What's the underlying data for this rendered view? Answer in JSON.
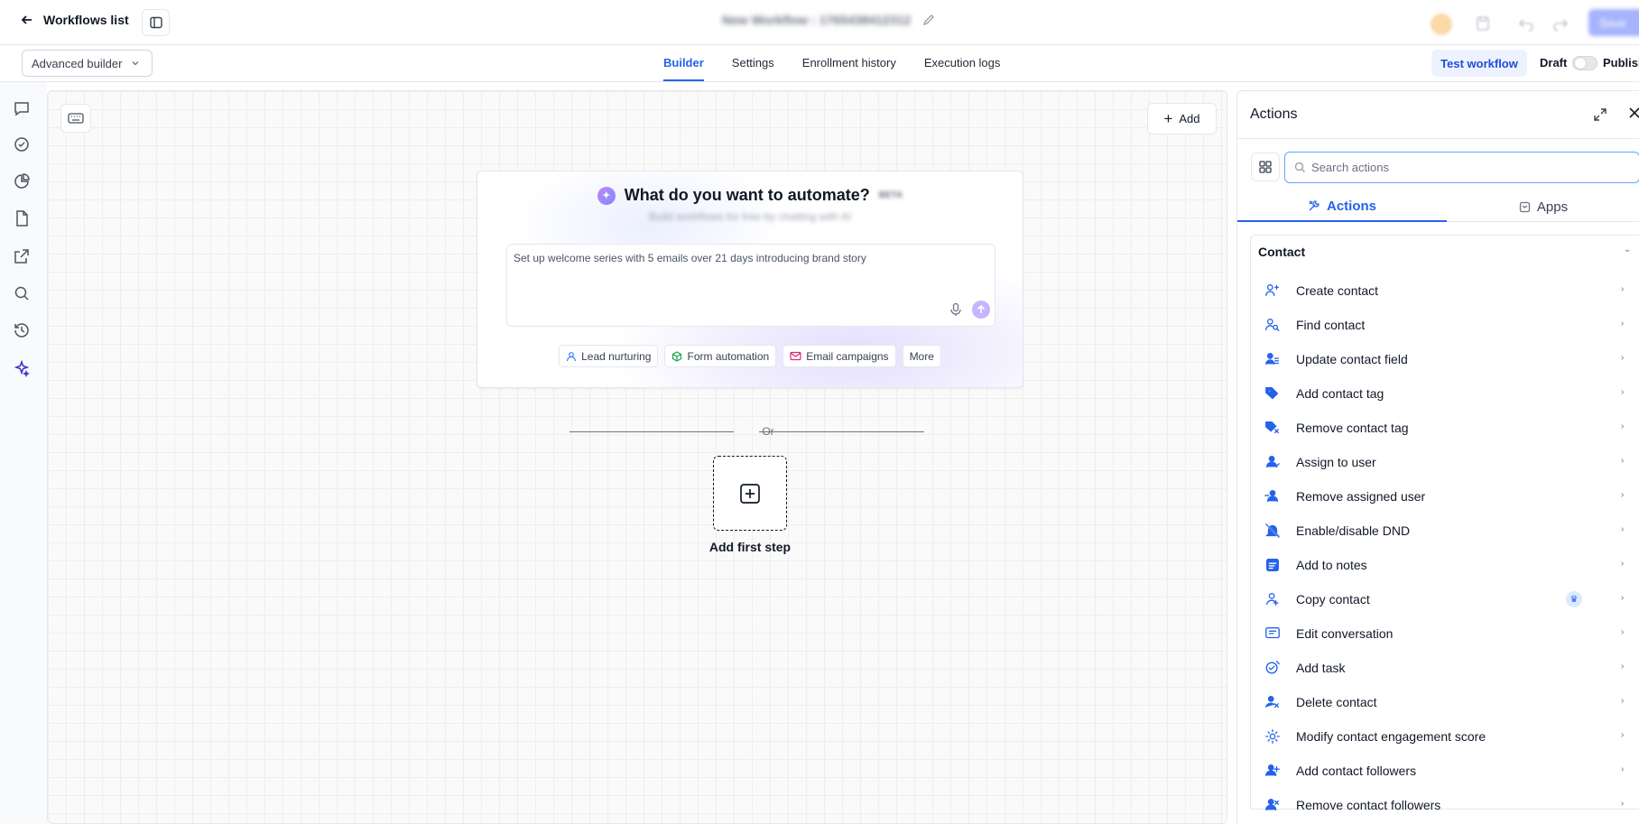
{
  "header": {
    "back_label": "Workflows list",
    "workflow_name": "New Workflow : 1765438412312",
    "save_label": "Save"
  },
  "subheader": {
    "builder_mode": "Advanced builder",
    "tabs": [
      {
        "label": "Builder",
        "active": true
      },
      {
        "label": "Settings",
        "active": false
      },
      {
        "label": "Enrollment history",
        "active": false
      },
      {
        "label": "Execution logs",
        "active": false
      }
    ],
    "test_label": "Test workflow",
    "draft_label": "Draft",
    "publish_label": "Publish"
  },
  "canvas": {
    "add_label": "Add",
    "ai": {
      "title": "What do you want to automate?",
      "beta": "BETA",
      "subtitle": "Build workflows for free by chatting with AI",
      "prompt": "Set up welcome series with 5 emails over 21 days introducing brand story",
      "chips": [
        "Lead nurturing",
        "Form automation",
        "Email campaigns",
        "More"
      ]
    },
    "or_label": "Or",
    "first_step_label": "Add first step"
  },
  "panel": {
    "title": "Actions",
    "search_placeholder": "Search actions",
    "tabs": [
      {
        "label": "Actions",
        "active": true
      },
      {
        "label": "Apps",
        "active": false
      }
    ],
    "group_title": "Contact",
    "actions": [
      {
        "label": "Create contact",
        "icon": "user-plus-icon"
      },
      {
        "label": "Find contact",
        "icon": "user-search-icon"
      },
      {
        "label": "Update contact field",
        "icon": "user-edit-icon"
      },
      {
        "label": "Add contact tag",
        "icon": "tag-icon"
      },
      {
        "label": "Remove contact tag",
        "icon": "tag-remove-icon"
      },
      {
        "label": "Assign to user",
        "icon": "user-assign-icon"
      },
      {
        "label": "Remove assigned user",
        "icon": "user-remove-icon"
      },
      {
        "label": "Enable/disable DND",
        "icon": "bell-off-icon"
      },
      {
        "label": "Add to notes",
        "icon": "note-icon"
      },
      {
        "label": "Copy contact",
        "icon": "user-copy-icon",
        "premium": true
      },
      {
        "label": "Edit conversation",
        "icon": "chat-edit-icon"
      },
      {
        "label": "Add task",
        "icon": "task-icon"
      },
      {
        "label": "Delete contact",
        "icon": "user-delete-icon"
      },
      {
        "label": "Modify contact engagement score",
        "icon": "score-icon"
      },
      {
        "label": "Add contact followers",
        "icon": "followers-add-icon"
      },
      {
        "label": "Remove contact followers",
        "icon": "followers-remove-icon"
      }
    ]
  }
}
